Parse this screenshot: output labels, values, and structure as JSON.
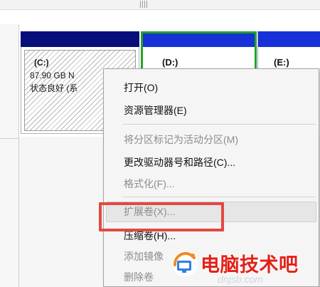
{
  "volumes": {
    "c": {
      "label": "(C:)",
      "size": "87.90 GB N",
      "status": "状态良好 (系"
    },
    "d": {
      "label": "(D:)"
    },
    "e": {
      "label": "(E:)"
    }
  },
  "context_menu": {
    "items": [
      {
        "label": "打开(O)",
        "enabled": true
      },
      {
        "label": "资源管理器(E)",
        "enabled": true
      },
      {
        "label": "将分区标记为活动分区(M)",
        "enabled": false
      },
      {
        "label": "更改驱动器号和路径(C)...",
        "enabled": true
      },
      {
        "label": "格式化(F)...",
        "enabled": false
      },
      {
        "label": "扩展卷(X)...",
        "enabled": false,
        "highlighted": true
      },
      {
        "label": "压缩卷(H)...",
        "enabled": true
      },
      {
        "label": "添加镜像",
        "enabled": false
      },
      {
        "label": "删除卷",
        "enabled": false
      }
    ]
  },
  "watermark": {
    "text": "电脑技术吧",
    "site": "dnjsb.com"
  },
  "colors": {
    "primary_bar": "#070e7c",
    "logical_bar": "#1730d8",
    "selected_border": "#23a323",
    "highlight_box": "#e24942",
    "watermark": "#e32019"
  }
}
